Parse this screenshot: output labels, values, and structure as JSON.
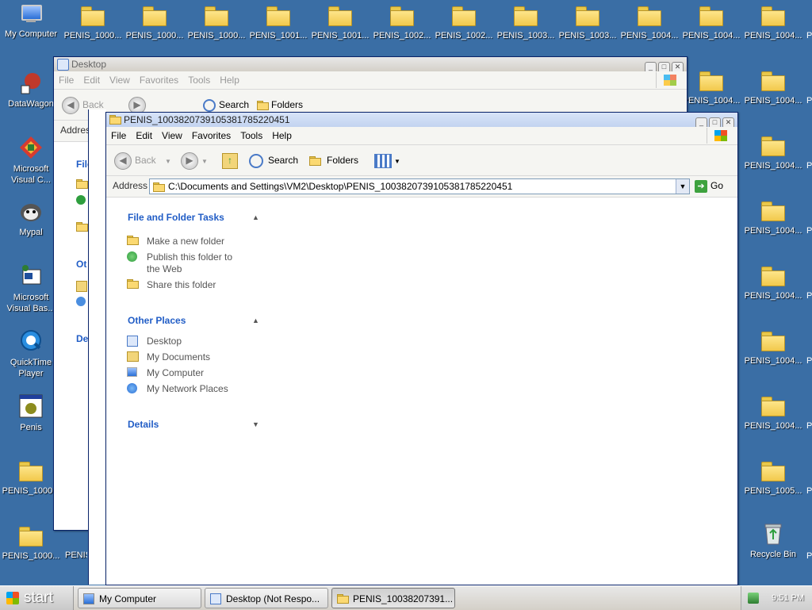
{
  "desktop": {
    "top_row": [
      {
        "label": "My Computer",
        "icon": "my-computer-icon"
      },
      {
        "label": "PENIS_1000...",
        "icon": "folder-icon"
      },
      {
        "label": "PENIS_1000...",
        "icon": "folder-icon"
      },
      {
        "label": "PENIS_1000...",
        "icon": "folder-icon"
      },
      {
        "label": "PENIS_1001...",
        "icon": "folder-icon"
      },
      {
        "label": "PENIS_1001...",
        "icon": "folder-icon"
      },
      {
        "label": "PENIS_1002...",
        "icon": "folder-icon"
      },
      {
        "label": "PENIS_1002...",
        "icon": "folder-icon"
      },
      {
        "label": "PENIS_1003...",
        "icon": "folder-icon"
      },
      {
        "label": "PENIS_1003...",
        "icon": "folder-icon"
      },
      {
        "label": "PENIS_1004...",
        "icon": "folder-icon"
      },
      {
        "label": "PENIS_1004...",
        "icon": "folder-icon"
      },
      {
        "label": "PENIS_1004...",
        "icon": "folder-icon"
      }
    ],
    "left_column": [
      {
        "label": "DataWagon",
        "icon": "datawagon-icon"
      },
      {
        "label": "Microsoft Visual C...",
        "icon": "visual-c-icon"
      },
      {
        "label": "Mypal",
        "icon": "mypal-icon"
      },
      {
        "label": "Microsoft Visual Bas...",
        "icon": "visual-basic-icon"
      },
      {
        "label": "QuickTime Player",
        "icon": "quicktime-icon"
      },
      {
        "label": "Penis",
        "icon": "penis-app-icon"
      },
      {
        "label": "PENIS_1000...",
        "icon": "folder-icon"
      },
      {
        "label": "PENIS_1000...",
        "icon": "folder-icon"
      }
    ],
    "partial_labels": [
      "PENIS_1004...",
      "PENIS_1004...",
      "PENIS_1004...",
      "PENIS_1004...",
      "PENIS_1004...",
      "PENIS_1004...",
      "PENIS_1004...",
      "PENIS_1004...",
      "PENIS_1005...",
      "PENIS"
    ],
    "right_column": [
      {
        "label": "PENIS_1004...",
        "icon": "folder-icon"
      },
      {
        "label": "PENIS_1004...",
        "icon": "folder-icon"
      },
      {
        "label": "PENIS_1004...",
        "icon": "folder-icon"
      },
      {
        "label": "PENIS_1004...",
        "icon": "folder-icon"
      },
      {
        "label": "PENIS_1004...",
        "icon": "folder-icon"
      },
      {
        "label": "PENIS_1004...",
        "icon": "folder-icon"
      },
      {
        "label": "PENIS_1004...",
        "icon": "folder-icon"
      },
      {
        "label": "PENIS_1005...",
        "icon": "folder-icon"
      },
      {
        "label": "Recycle Bin",
        "icon": "recycle-bin-icon"
      }
    ],
    "second_column_partial": [
      {
        "label": "PENIS_1004...",
        "icon": "folder-icon"
      }
    ],
    "right_edge_letter": "P"
  },
  "back_window": {
    "title": "Desktop",
    "menu": [
      "File",
      "Edit",
      "View",
      "Favorites",
      "Tools",
      "Help"
    ],
    "toolbar": {
      "back": "Back",
      "search": "Search",
      "folders": "Folders"
    },
    "address_label": "Addres",
    "side_fragments": [
      "File",
      "Ot",
      "De"
    ]
  },
  "window": {
    "title": "PENIS_10038207391053817852204​51",
    "menu": [
      "File",
      "Edit",
      "View",
      "Favorites",
      "Tools",
      "Help"
    ],
    "toolbar": {
      "back": "Back",
      "search": "Search",
      "folders": "Folders"
    },
    "address_label": "Address",
    "address_value": "C:\\Documents and Settings\\VM2\\Desktop\\PENIS_100382073910538178522045​1",
    "go_label": "Go",
    "tasks_title": "File and Folder Tasks",
    "tasks": [
      {
        "label": "Make a new folder",
        "icon": "new-folder-icon"
      },
      {
        "label": "Publish this folder to the Web",
        "icon": "publish-web-icon"
      },
      {
        "label": "Share this folder",
        "icon": "share-folder-icon"
      }
    ],
    "places_title": "Other Places",
    "places": [
      {
        "label": "Desktop",
        "icon": "desktop-icon"
      },
      {
        "label": "My Documents",
        "icon": "my-documents-icon"
      },
      {
        "label": "My Computer",
        "icon": "my-computer-icon"
      },
      {
        "label": "My Network Places",
        "icon": "network-places-icon"
      }
    ],
    "details_title": "Details"
  },
  "taskbar": {
    "start": "start",
    "buttons": [
      {
        "label": "My Computer",
        "icon": "my-computer-icon"
      },
      {
        "label": "Desktop (Not Respo...",
        "icon": "explorer-icon"
      },
      {
        "label": "PENIS_10038207391...",
        "icon": "folder-icon"
      }
    ],
    "clock": "9:51 PM"
  }
}
